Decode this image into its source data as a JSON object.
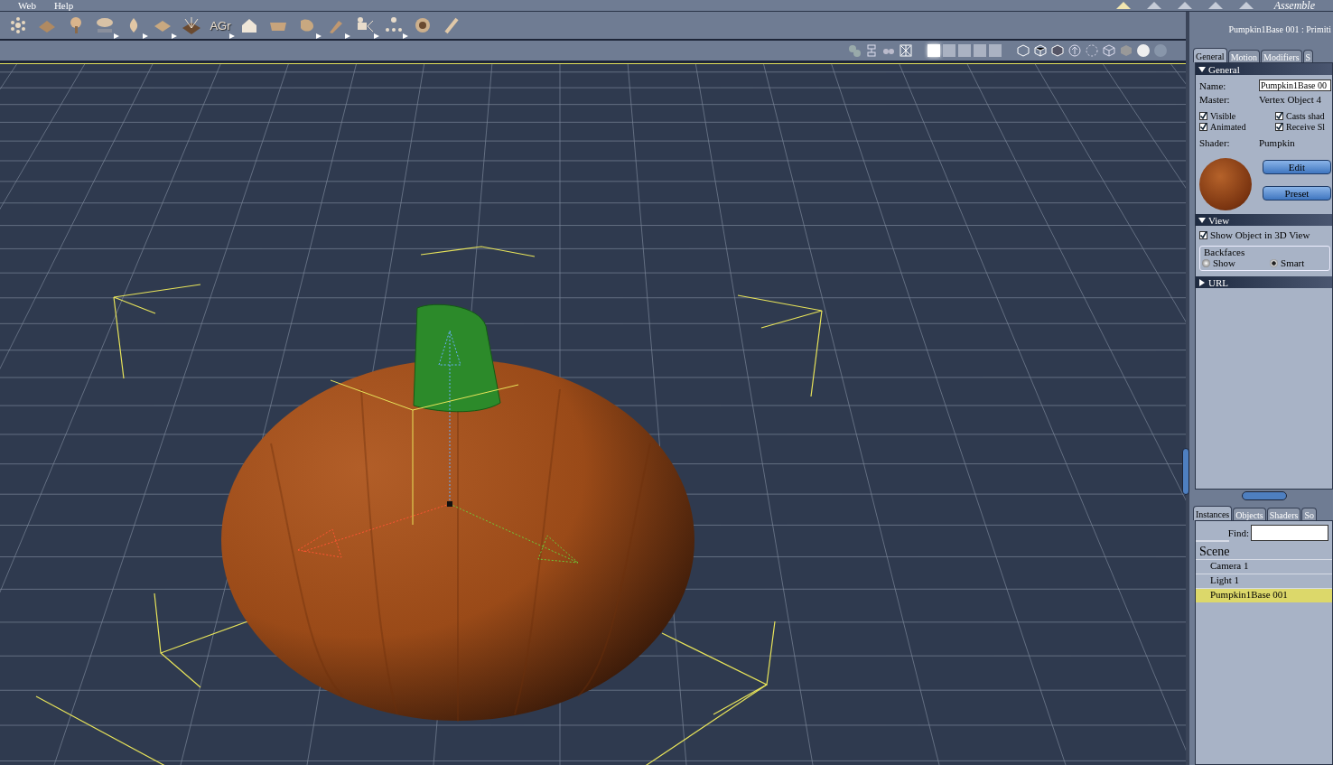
{
  "menu": [
    "Web",
    "Help"
  ],
  "room_tabs": [
    {
      "selected": true
    },
    {
      "selected": false
    },
    {
      "selected": false
    },
    {
      "selected": false
    },
    {
      "selected": false
    }
  ],
  "room_title": "Assemble",
  "tools": [
    {
      "kind": "icon",
      "menu": false
    },
    {
      "kind": "icon",
      "menu": false
    },
    {
      "kind": "icon",
      "menu": false
    },
    {
      "kind": "icon",
      "menu": true
    },
    {
      "kind": "icon",
      "menu": true
    },
    {
      "kind": "icon",
      "menu": true
    },
    {
      "kind": "icon",
      "menu": false
    },
    {
      "kind": "text",
      "label": "AGr",
      "menu": true
    },
    {
      "kind": "icon",
      "menu": false
    },
    {
      "kind": "icon",
      "menu": false
    },
    {
      "kind": "icon",
      "menu": true
    },
    {
      "kind": "icon",
      "menu": true
    },
    {
      "kind": "icon",
      "menu": true
    },
    {
      "kind": "icon",
      "menu": true
    },
    {
      "kind": "icon",
      "menu": false
    },
    {
      "kind": "icon",
      "menu": false
    }
  ],
  "layouts": [
    {
      "selected": true
    },
    {
      "selected": false
    },
    {
      "selected": false
    },
    {
      "selected": false
    },
    {
      "selected": false
    }
  ],
  "panel": {
    "title": "Pumpkin1Base 001 : Primiti",
    "tabs": [
      {
        "label": "General",
        "selected": true
      },
      {
        "label": "Motion",
        "selected": false
      },
      {
        "label": "Modifiers",
        "selected": false
      },
      {
        "label": "S",
        "selected": false
      }
    ],
    "general": {
      "header": "General",
      "expanded": true,
      "name_label": "Name:",
      "name_value": "Pumpkin1Base 00",
      "master_label": "Master:",
      "master_value": "Vertex Object 4",
      "checks": [
        {
          "label": "Visible",
          "checked": true
        },
        {
          "label": "Casts shad",
          "checked": true
        },
        {
          "label": "Animated",
          "checked": true
        },
        {
          "label": "Receive Sl",
          "checked": true
        }
      ],
      "shader_label": "Shader:",
      "shader_value": "Pumpkin",
      "buttons": [
        "Edit",
        "Preset"
      ]
    },
    "view": {
      "header": "View",
      "expanded": true,
      "show_label": "Show Object in 3D View",
      "show_checked": true,
      "backfaces_label": "Backfaces",
      "radios": [
        {
          "label": "Show",
          "selected": false
        },
        {
          "label": "Smart",
          "selected": true
        }
      ]
    },
    "url": {
      "header": "URL",
      "expanded": false
    }
  },
  "browser": {
    "tabs": [
      {
        "label": "Instances",
        "selected": true
      },
      {
        "label": "Objects",
        "selected": false
      },
      {
        "label": "Shaders",
        "selected": false
      },
      {
        "label": "So",
        "selected": false
      }
    ],
    "find_label": "Find:",
    "scene_label": "Scene",
    "rows": [
      {
        "label": "Camera 1",
        "selected": false
      },
      {
        "label": "Light 1",
        "selected": false
      },
      {
        "label": "Pumpkin1Base 001",
        "selected": true
      }
    ]
  }
}
